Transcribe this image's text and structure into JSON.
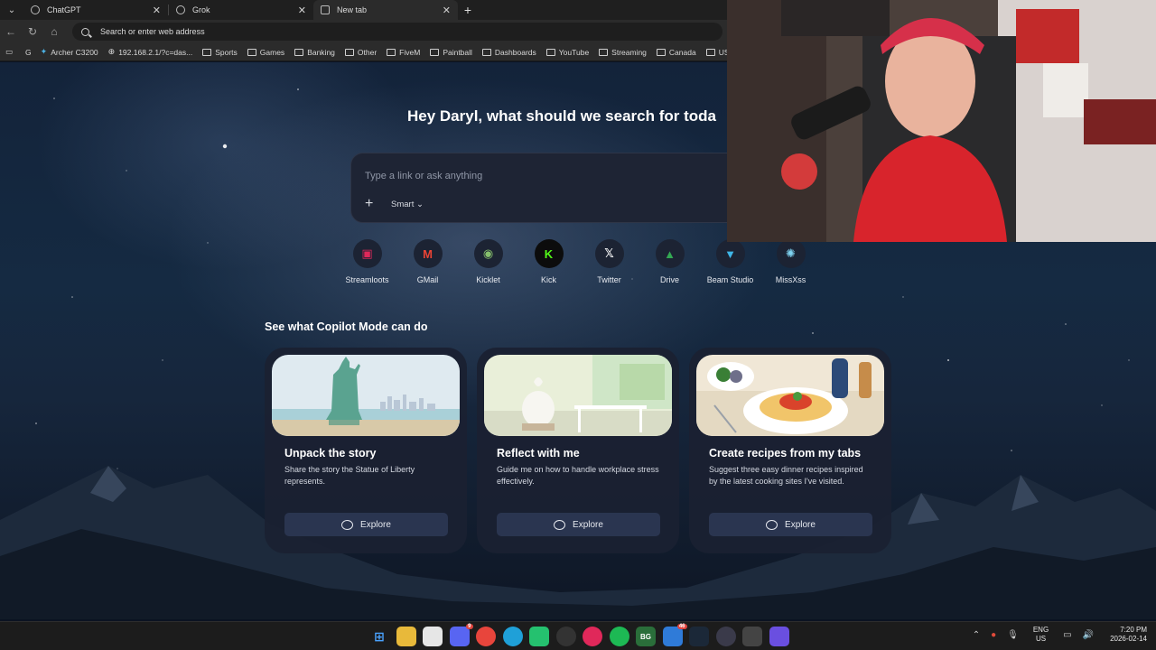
{
  "tabs": [
    {
      "title": "ChatGPT",
      "icon": "chatgpt-icon"
    },
    {
      "title": "Grok",
      "icon": "grok-icon"
    },
    {
      "title": "New tab",
      "icon": "newtab-icon"
    }
  ],
  "toolbar": {
    "address_placeholder": "Search or enter web address"
  },
  "bookmarks": [
    {
      "label": "Archer C3200",
      "type": "site"
    },
    {
      "label": "192.168.2.1/?c=das...",
      "type": "site"
    },
    {
      "label": "Sports",
      "type": "folder"
    },
    {
      "label": "Games",
      "type": "folder"
    },
    {
      "label": "Banking",
      "type": "folder"
    },
    {
      "label": "Other",
      "type": "folder"
    },
    {
      "label": "FiveM",
      "type": "folder"
    },
    {
      "label": "Paintball",
      "type": "folder"
    },
    {
      "label": "Dashboards",
      "type": "folder"
    },
    {
      "label": "YouTube",
      "type": "folder"
    },
    {
      "label": "Streaming",
      "type": "folder"
    },
    {
      "label": "Canada",
      "type": "folder"
    },
    {
      "label": "USA",
      "type": "folder"
    }
  ],
  "newtab": {
    "greeting": "Hey Daryl, what should we search for toda",
    "search_placeholder": "Type a link or ask anything",
    "mode_label": "Smart",
    "shortcuts": [
      {
        "label": "Streamloots",
        "glyph": "▣",
        "color": "#e0285a"
      },
      {
        "label": "GMail",
        "glyph": "M",
        "color": "#ea4335"
      },
      {
        "label": "Kicklet",
        "glyph": "◉",
        "color": "#86c06c"
      },
      {
        "label": "Kick",
        "glyph": "K",
        "color": "#53fc18"
      },
      {
        "label": "Twitter",
        "glyph": "𝕏",
        "color": "#ffffff"
      },
      {
        "label": "Drive",
        "glyph": "▲",
        "color": "#34a853"
      },
      {
        "label": "Beam Studio",
        "glyph": "▼",
        "color": "#3fb6e8"
      },
      {
        "label": "MissXss",
        "glyph": "✺",
        "color": "#7fd3f0"
      }
    ],
    "section_title": "See what Copilot Mode can do",
    "cards": [
      {
        "title": "Unpack the story",
        "desc": "Share the story the Statue of Liberty represents.",
        "button": "Explore"
      },
      {
        "title": "Reflect with me",
        "desc": "Guide me on how to handle workplace stress effectively.",
        "button": "Explore"
      },
      {
        "title": "Create recipes from my tabs",
        "desc": "Suggest three easy dinner recipes inspired by the latest cooking sites I've visited.",
        "button": "Explore"
      }
    ]
  },
  "taskbar": {
    "badges": {
      "discord": "9",
      "mail": "46"
    },
    "bg_label": "BG",
    "lang_top": "ENG",
    "lang_bottom": "US",
    "time": "7:20 PM",
    "date": "2026-02-14"
  }
}
